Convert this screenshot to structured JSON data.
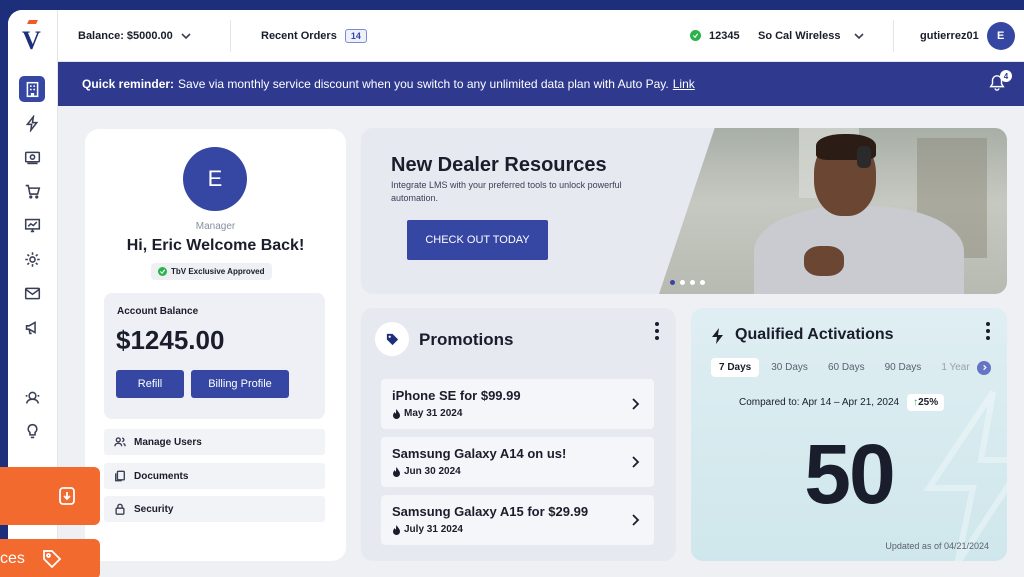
{
  "topbar": {
    "balance_label": "Balance: $5000.00",
    "recent_orders_label": "Recent Orders",
    "recent_orders_count": "14",
    "store_id": "12345",
    "store_name": "So Cal Wireless",
    "username": "gutierrez01",
    "user_initial": "E"
  },
  "reminder": {
    "prefix": "Quick reminder:",
    "message": "Save via monthly service discount when you switch to any unlimited data plan with Auto Pay.",
    "link": "Link",
    "notification_count": "4"
  },
  "profile": {
    "initial": "E",
    "role": "Manager",
    "greeting": "Hi, Eric Welcome Back!",
    "badge": "TbV Exclusive Approved",
    "balance_label": "Account Balance",
    "balance_value": "$1245.00",
    "refill_label": "Refill",
    "billing_label": "Billing Profile",
    "menu": [
      {
        "label": "Manage Users",
        "icon": "users-icon"
      },
      {
        "label": "Documents",
        "icon": "documents-icon"
      },
      {
        "label": "Security",
        "icon": "lock-icon"
      }
    ]
  },
  "dealer": {
    "title": "New Dealer Resources",
    "subtitle": "Integrate LMS with your preferred tools to unlock powerful automation.",
    "cta": "CHECK OUT TODAY",
    "slides": 4,
    "active_slide": 1
  },
  "promotions": {
    "title": "Promotions",
    "items": [
      {
        "name": "iPhone SE for $99.99",
        "date": "May 31 2024"
      },
      {
        "name": "Samsung Galaxy A14 on us!",
        "date": "Jun 30 2024"
      },
      {
        "name": "Samsung Galaxy A15 for $29.99",
        "date": "July 31 2024"
      }
    ]
  },
  "activations": {
    "title": "Qualified Activations",
    "tabs": [
      "7 Days",
      "30 Days",
      "60 Days",
      "90 Days",
      "1 Year"
    ],
    "active_tab": 0,
    "compare_text": "Compared to: Apr 14 – Apr 21, 2024",
    "change": "25%",
    "value": "50",
    "updated": "Updated as of 04/21/2024"
  },
  "floating": {
    "services_label": "ces"
  },
  "colors": {
    "brand": "#3547a3",
    "banner": "#2f3a8f",
    "accent_orange": "#f26a2e",
    "success": "#2ab24b"
  }
}
